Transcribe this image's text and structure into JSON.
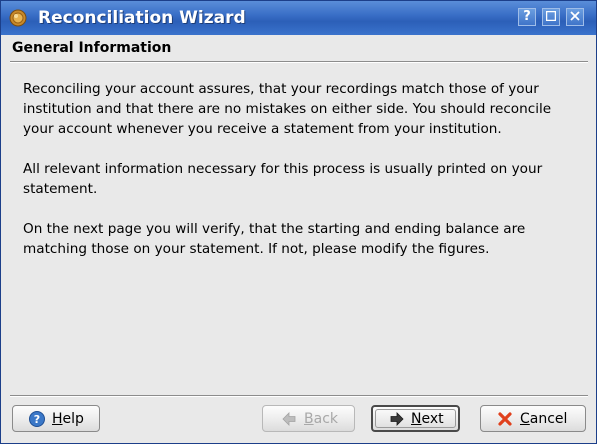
{
  "window": {
    "title": "Reconciliation Wizard",
    "help_glyph": "?",
    "icons": {
      "app": "kmymoney-coin-icon",
      "help": "help-icon",
      "maximize": "maximize-icon",
      "close": "close-icon"
    }
  },
  "page": {
    "heading": "General Information",
    "paragraphs": [
      "Reconciling your account assures, that your recordings match those of your institution and that there are no mistakes on either side. You should reconcile your account whenever you receive a statement from your institution.",
      "All relevant information necessary for this process is usually printed on your statement.",
      "On the next page you will verify, that the starting and ending balance are matching those on your statement. If not, please modify the figures."
    ]
  },
  "buttons": {
    "help": {
      "mnemonic": "H",
      "rest": "elp",
      "icon": "help-circle-icon",
      "enabled": true
    },
    "back": {
      "mnemonic": "B",
      "rest": "ack",
      "icon": "arrow-left-icon",
      "enabled": false
    },
    "next": {
      "mnemonic": "N",
      "rest": "ext",
      "icon": "arrow-right-icon",
      "enabled": true,
      "default": true
    },
    "cancel": {
      "mnemonic": "C",
      "rest": "ancel",
      "icon": "cancel-x-icon",
      "enabled": true
    }
  },
  "colors": {
    "titlebar": "#3a6fc7",
    "window_bg": "#e9e9e9",
    "cancel_icon": "#e0401c",
    "help_icon": "#3b78c8",
    "disabled_text": "#a8a8a8"
  }
}
